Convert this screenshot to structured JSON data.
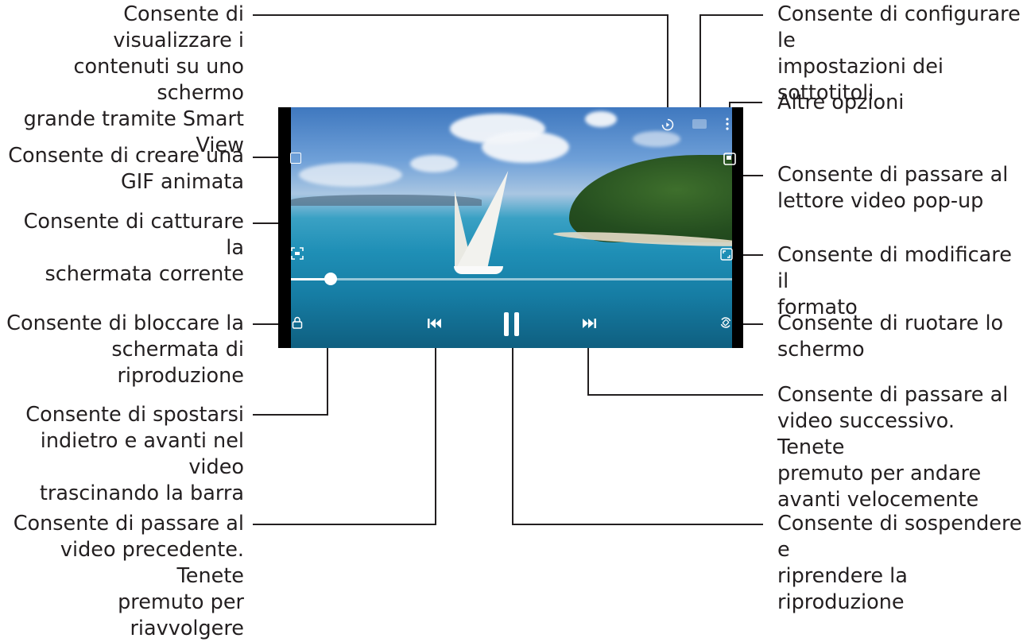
{
  "colors": {
    "text": "#231f20",
    "screen_bg": "#000000",
    "sea": "#1f8fb6",
    "sky": "#3f78bf"
  },
  "player": {
    "seek_progress": 0.09,
    "icons": {
      "gif": "gif-icon",
      "capture": "capture-icon",
      "lock": "lock-icon",
      "smart_view": "smart-view-icon",
      "subtitles": "subtitles-icon",
      "more": "more-options-icon",
      "popup": "popup-player-icon",
      "ratio": "ratio-icon",
      "rotate": "rotate-icon",
      "previous": "previous-icon",
      "pause": "pause-icon",
      "next": "next-icon"
    }
  },
  "callouts": {
    "smart_view": "Consente di visualizzare i\ncontenuti su uno schermo\ngrande tramite Smart View",
    "gif": "Consente di creare una\nGIF animata",
    "capture": "Consente di catturare la\nschermata corrente",
    "lock": "Consente di bloccare la\nschermata di riproduzione",
    "seek": "Consente di spostarsi\nindietro e avanti nel video\ntrascinando la barra",
    "previous": "Consente di passare al\nvideo precedente. Tenete\npremuto per riavvolgere",
    "subtitles": "Consente di configurare le\nimpostazioni dei\nsottotitoli",
    "more": "Altre opzioni",
    "popup": "Consente di passare al\nlettore video pop-up",
    "ratio": "Consente di modificare il\nformato",
    "rotate": "Consente di ruotare lo\nschermo",
    "next": "Consente di passare al\nvideo successivo. Tenete\npremuto per andare\navanti velocemente",
    "pause": "Consente di sospendere e\nriprendere la riproduzione"
  }
}
